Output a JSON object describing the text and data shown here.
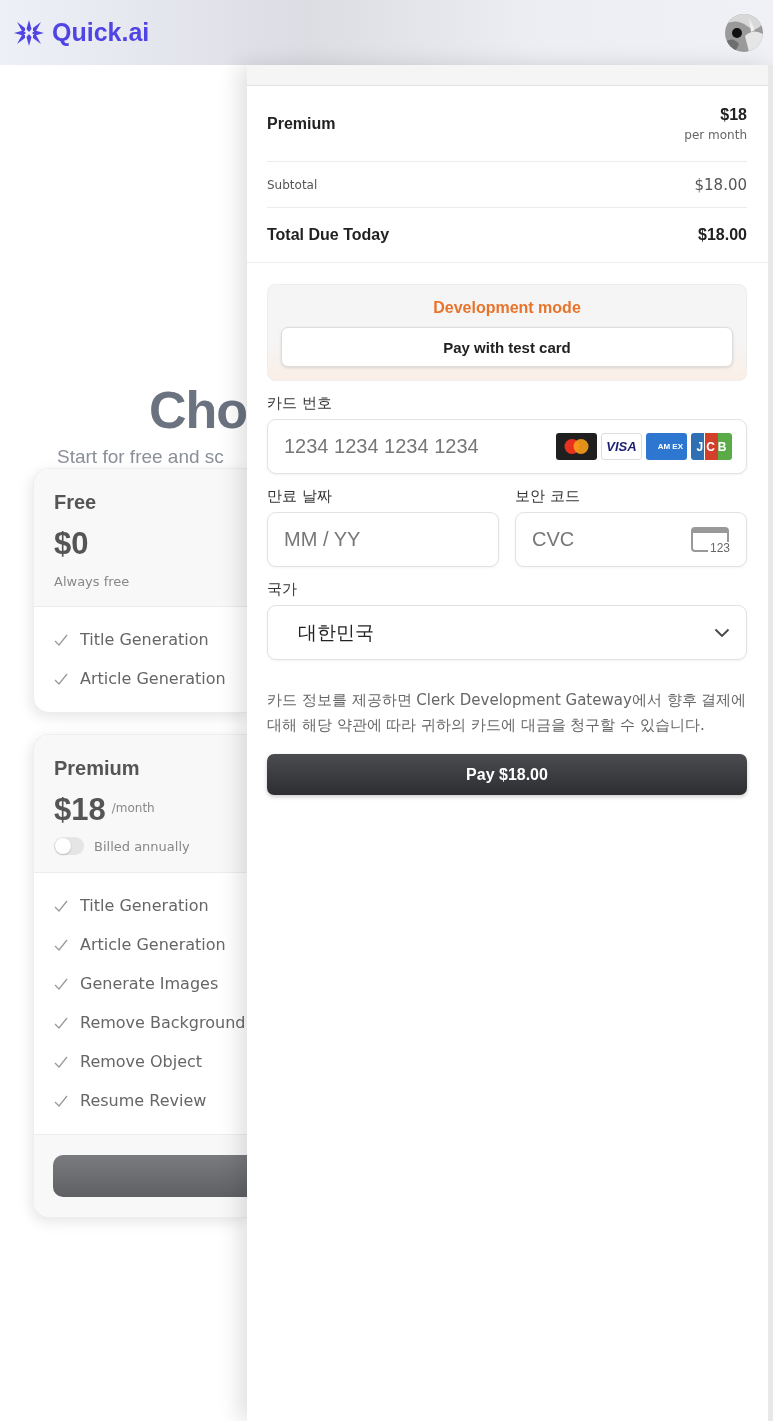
{
  "header": {
    "logo_text": "Quick.ai"
  },
  "hero": {
    "title": "Cho",
    "subtitle": "Start for free and sc"
  },
  "plans": [
    {
      "kind": "free",
      "name": "Free",
      "price": "$0",
      "note": "Always free",
      "features": [
        "Title Generation",
        "Article Generation"
      ]
    },
    {
      "kind": "premium",
      "name": "Premium",
      "price": "$18",
      "period": "/month",
      "toggle": {
        "label": "Billed annually",
        "on": false
      },
      "features": [
        "Title Generation",
        "Article Generation",
        "Generate Images",
        "Remove Background",
        "Remove Object",
        "Resume Review"
      ]
    }
  ],
  "checkout": {
    "plan": {
      "name": "Premium",
      "price": "$18",
      "period": "per month"
    },
    "subtotal": {
      "label": "Subtotal",
      "value": "$18.00"
    },
    "total": {
      "label": "Total Due Today",
      "value": "$18.00"
    },
    "dev_mode": {
      "title": "Development mode",
      "button": "Pay with test card"
    },
    "card_number": {
      "label": "카드 번호",
      "placeholder": "1234 1234 1234 1234",
      "brands": [
        {
          "kind": "mastercard"
        },
        {
          "kind": "visa",
          "label": "VISA"
        },
        {
          "kind": "amex",
          "label": "AM EX"
        },
        {
          "kind": "jcb",
          "label": "JCB"
        }
      ]
    },
    "expiry": {
      "label": "만료 날짜",
      "placeholder": "MM / YY"
    },
    "cvc": {
      "label": "보안 코드",
      "placeholder": "CVC",
      "icon_text": "123"
    },
    "country": {
      "label": "국가",
      "value": "대한민국"
    },
    "terms": "카드 정보를 제공하면 Clerk Development Gateway에서 향후 결제에 대해 해당 약관에 따라 귀하의 카드에 대금을 청구할 수 있습니다.",
    "pay_button": "Pay $18.00"
  }
}
